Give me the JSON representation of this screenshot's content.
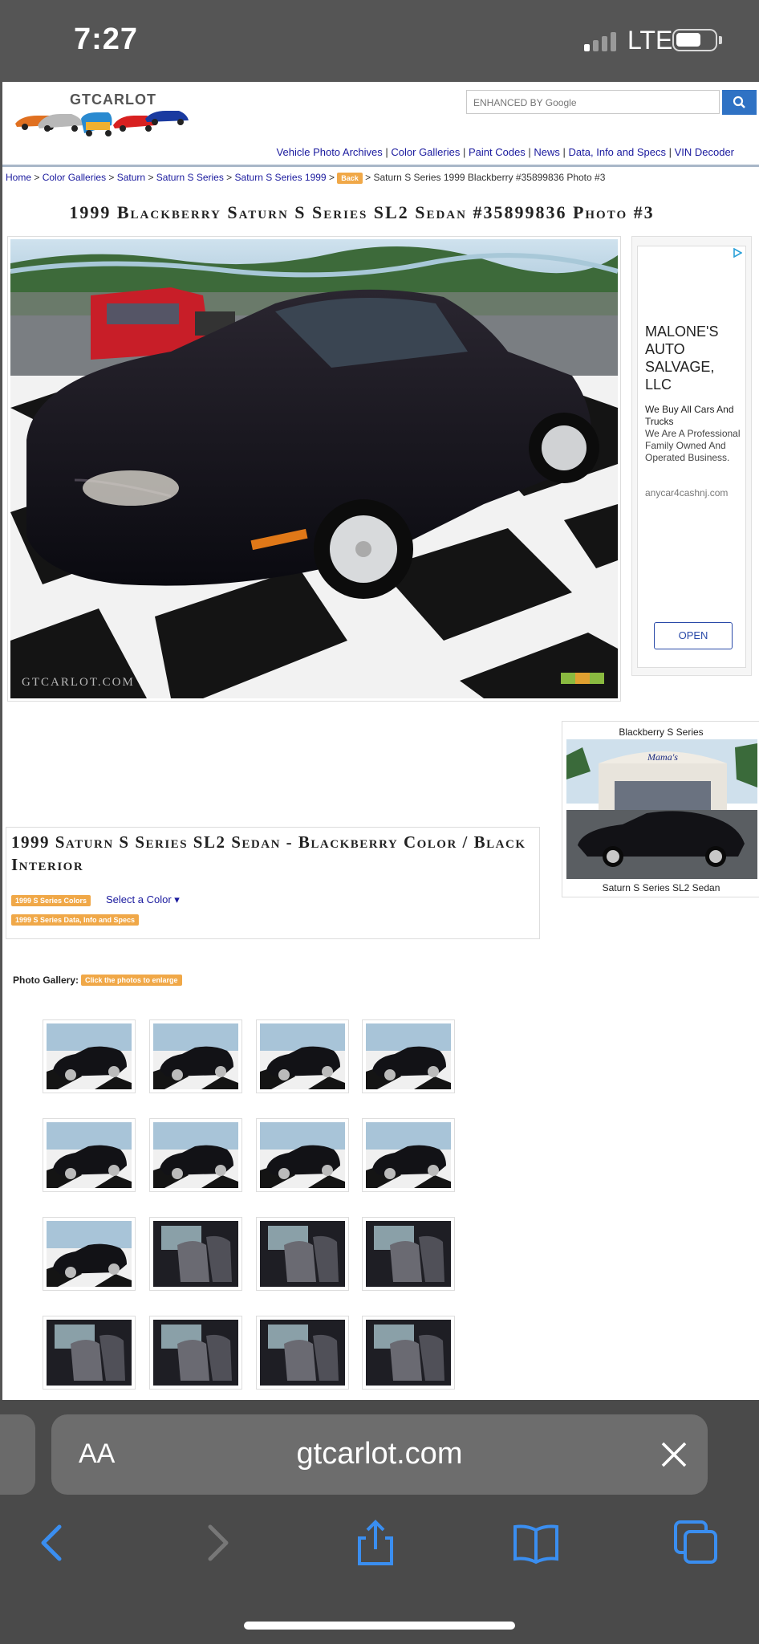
{
  "status_bar": {
    "time": "7:27",
    "network": "LTE"
  },
  "site": {
    "logo": "GTCARLOT",
    "search_placeholder": "ENHANCED BY Google",
    "nav": [
      "Vehicle Photo Archives",
      "Color Galleries",
      "Paint Codes",
      "News",
      "Data, Info and Specs",
      "VIN Decoder"
    ],
    "breadcrumb": [
      "Home",
      "Color Galleries",
      "Saturn",
      "Saturn S Series",
      "Saturn S Series 1999"
    ],
    "back_label": "Back",
    "breadcrumb_current": "Saturn S Series 1999 Blackberry #35899836 Photo #3",
    "page_title": "1999 Blackberry Saturn S Series SL2 Sedan #35899836 Photo #3",
    "photo_watermark": "GTCARLOT.COM"
  },
  "ad": {
    "name": "MALONE'S AUTO SALVAGE, LLC",
    "line1": "We Buy All Cars And Trucks",
    "line2": "We Are A Professional Family Owned And Operated Business.",
    "url": "anycar4cashnj.com",
    "cta": "OPEN"
  },
  "side_card": {
    "title": "Blackberry S Series",
    "sign_text": "Mama's",
    "caption": "Saturn S Series SL2 Sedan"
  },
  "info": {
    "title": "1999 Saturn S Series SL2 Sedan - Blackberry Color / Black Interior",
    "colors_badge": "1999 S Series Colors",
    "select_color": "Select a Color ▾",
    "data_badge": "1999 S Series Data, Info and Specs"
  },
  "gallery": {
    "label": "Photo Gallery:",
    "hint": "Click the photos to enlarge",
    "thumbs": [
      "exterior",
      "exterior",
      "exterior",
      "exterior",
      "exterior",
      "exterior",
      "exterior",
      "exterior",
      "exterior",
      "interior",
      "interior",
      "interior",
      "interior",
      "interior",
      "interior",
      "interior"
    ]
  },
  "safari": {
    "aa": "AA",
    "url": "gtcarlot.com"
  },
  "colors": {
    "link": "#1a1a9e",
    "badge": "#f0a848",
    "accent": "#2f72c4",
    "car": "#111118"
  }
}
